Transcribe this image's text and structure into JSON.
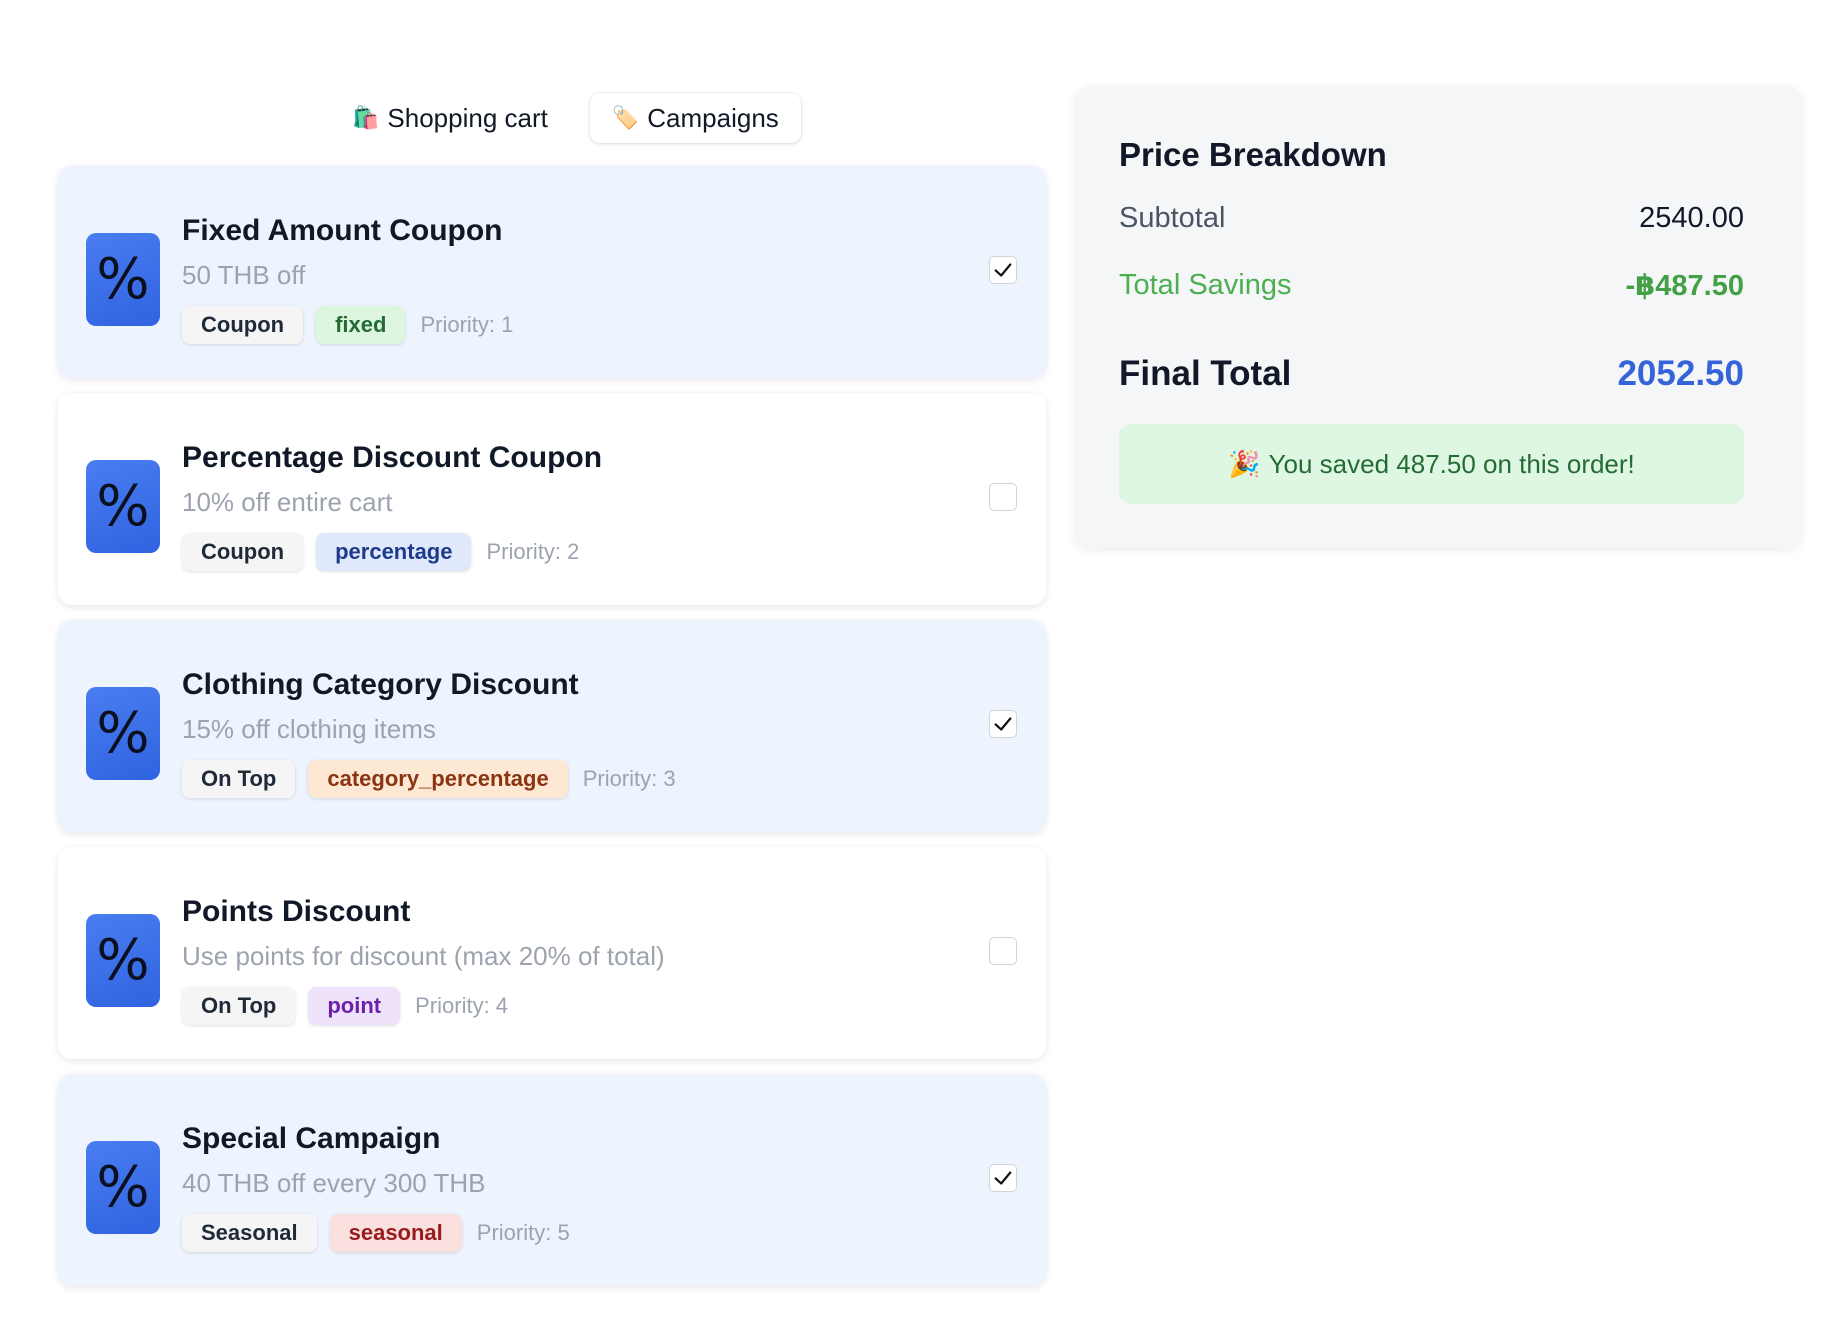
{
  "tabs": [
    {
      "icon": "🛍️",
      "label": "Shopping cart"
    },
    {
      "icon": "🏷️",
      "label": "Campaigns"
    }
  ],
  "campaigns": [
    {
      "title": "Fixed Amount Coupon",
      "description": "50 THB off",
      "category": "Coupon",
      "type": "fixed",
      "priority": "Priority: 1",
      "checked": true
    },
    {
      "title": "Percentage Discount Coupon",
      "description": "10% off entire cart",
      "category": "Coupon",
      "type": "percentage",
      "priority": "Priority: 2",
      "checked": false
    },
    {
      "title": "Clothing Category Discount",
      "description": "15% off clothing items",
      "category": "On Top",
      "type": "category_percentage",
      "priority": "Priority: 3",
      "checked": true
    },
    {
      "title": "Points Discount",
      "description": "Use points for discount (max 20% of total)",
      "category": "On Top",
      "type": "point",
      "priority": "Priority: 4",
      "checked": false
    },
    {
      "title": "Special Campaign",
      "description": "40 THB off every 300 THB",
      "category": "Seasonal",
      "type": "seasonal",
      "priority": "Priority: 5",
      "checked": true
    }
  ],
  "campaign_icon": "%",
  "summary": {
    "title": "Price Breakdown",
    "subtotal_label": "Subtotal",
    "subtotal_value": "2540.00",
    "savings_label": "Total Savings",
    "savings_value": "-฿487.50",
    "final_label": "Final Total",
    "final_value": "2052.50",
    "saved_icon": "🎉",
    "saved_message": "You saved 487.50 on this order!"
  },
  "colors": {
    "accent_blue": "#3563d9",
    "savings_green": "#43a047",
    "selected_card_bg": "#eef4fe"
  }
}
